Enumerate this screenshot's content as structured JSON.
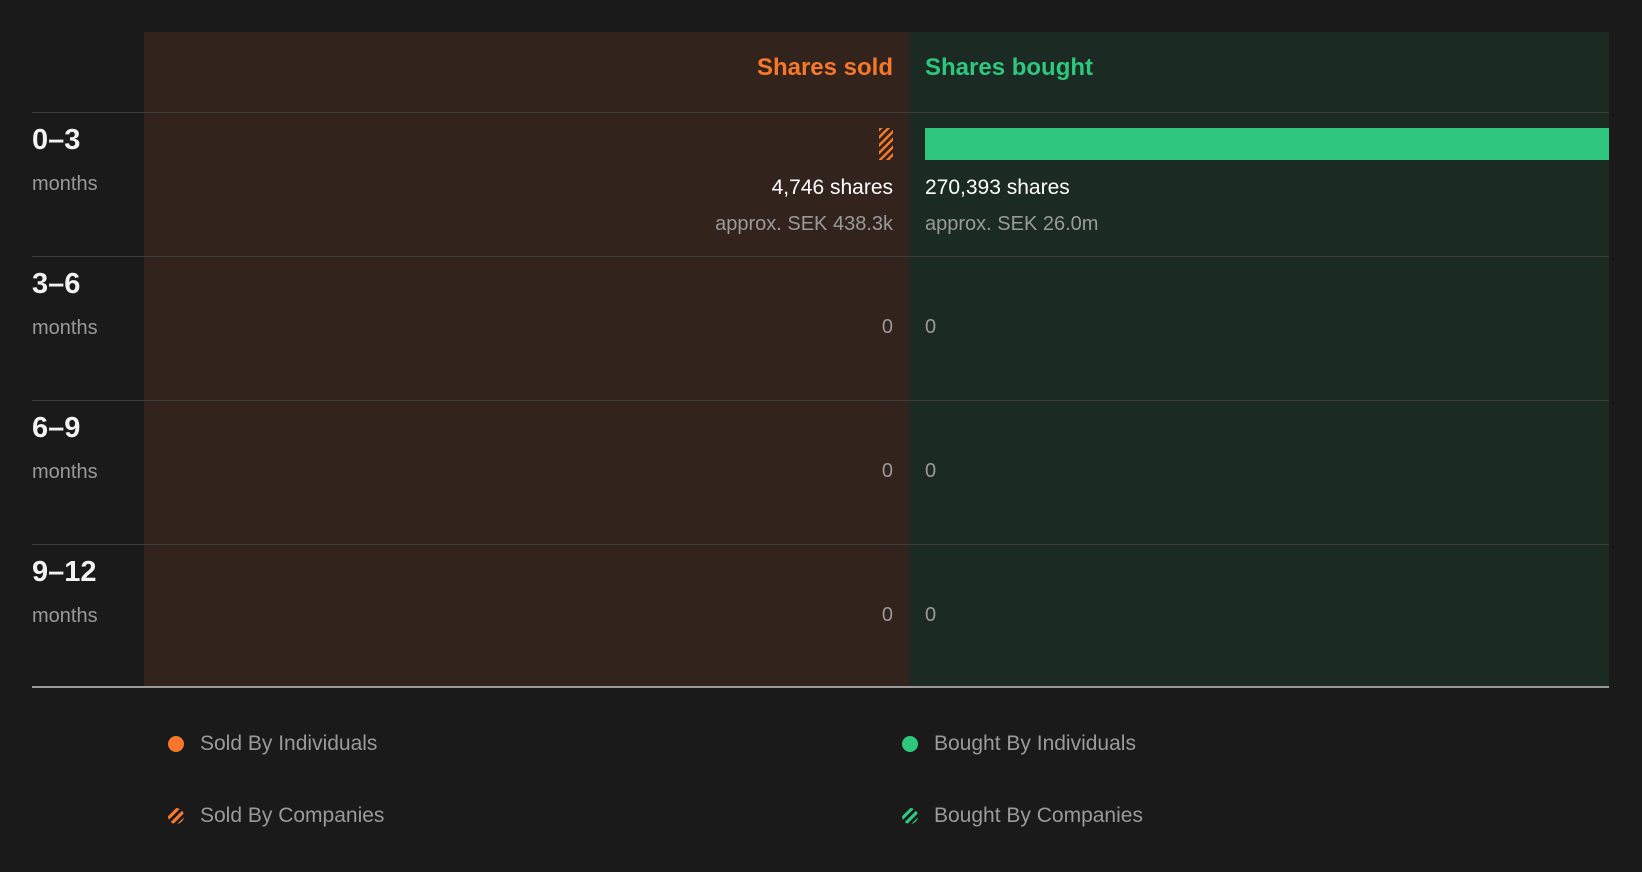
{
  "chart_data": {
    "type": "bar",
    "headers": {
      "sold": "Shares sold",
      "bought": "Shares bought"
    },
    "colors": {
      "sold": "#f5782b",
      "bought": "#2ec77d",
      "sold_panel": "#32231c",
      "bought_panel": "#1c2a24",
      "background": "#1a1a1a"
    },
    "rows": [
      {
        "range": "0–3",
        "unit": "months",
        "sold_shares": 4746,
        "sold_shares_label": "4,746 shares",
        "sold_value_label": "approx. SEK 438.3k",
        "sold_by": "companies",
        "bought_shares": 270393,
        "bought_shares_label": "270,393 shares",
        "bought_value_label": "approx. SEK 26.0m",
        "bought_by": "individuals"
      },
      {
        "range": "3–6",
        "unit": "months",
        "sold_shares": 0,
        "sold_shares_label": "0",
        "bought_shares": 0,
        "bought_shares_label": "0"
      },
      {
        "range": "6–9",
        "unit": "months",
        "sold_shares": 0,
        "sold_shares_label": "0",
        "bought_shares": 0,
        "bought_shares_label": "0"
      },
      {
        "range": "9–12",
        "unit": "months",
        "sold_shares": 0,
        "sold_shares_label": "0",
        "bought_shares": 0,
        "bought_shares_label": "0"
      }
    ],
    "legend": [
      {
        "label": "Sold By Individuals",
        "style": "solid",
        "color": "#f5782b"
      },
      {
        "label": "Bought By Individuals",
        "style": "solid",
        "color": "#2ec77d"
      },
      {
        "label": "Sold By Companies",
        "style": "striped",
        "color": "#f5782b"
      },
      {
        "label": "Bought By Companies",
        "style": "striped",
        "color": "#2ec77d"
      }
    ]
  }
}
